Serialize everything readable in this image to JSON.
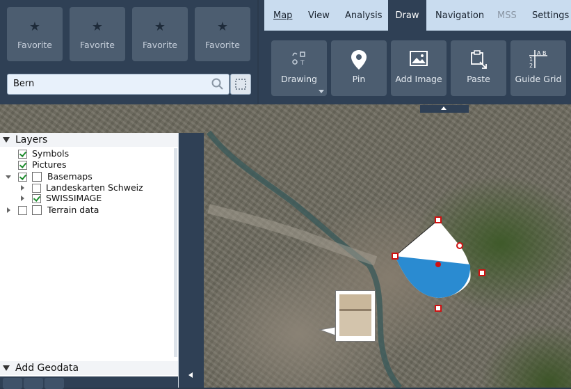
{
  "favorites": [
    {
      "label": "Favorite",
      "icon": "star-icon"
    },
    {
      "label": "Favorite",
      "icon": "star-icon"
    },
    {
      "label": "Favorite",
      "icon": "star-icon"
    },
    {
      "label": "Favorite",
      "icon": "star-icon"
    }
  ],
  "search": {
    "value": "Bern"
  },
  "menu": {
    "map": "Map",
    "view": "View",
    "analysis": "Analysis",
    "draw": "Draw",
    "navigation": "Navigation",
    "mss": "MSS",
    "settings": "Settings"
  },
  "tools": {
    "drawing": "Drawing",
    "pin": "Pin",
    "add_image": "Add Image",
    "paste": "Paste",
    "guide_grid": "Guide Grid"
  },
  "layers": {
    "title": "Layers",
    "items": [
      {
        "label": "Symbols",
        "checked": true
      },
      {
        "label": "Pictures",
        "checked": true
      },
      {
        "label": "Basemaps",
        "checked": true
      },
      {
        "label": "Landeskarten Schweiz",
        "checked": false
      },
      {
        "label": "SWISSIMAGE",
        "checked": true
      },
      {
        "label": "Terrain data",
        "checked": false
      }
    ]
  },
  "geodata": {
    "title": "Add Geodata"
  },
  "colors": {
    "accent": "#2a8bd1",
    "panel": "#2f4055",
    "menubar": "#c9dcef",
    "handle": "#d01010"
  }
}
